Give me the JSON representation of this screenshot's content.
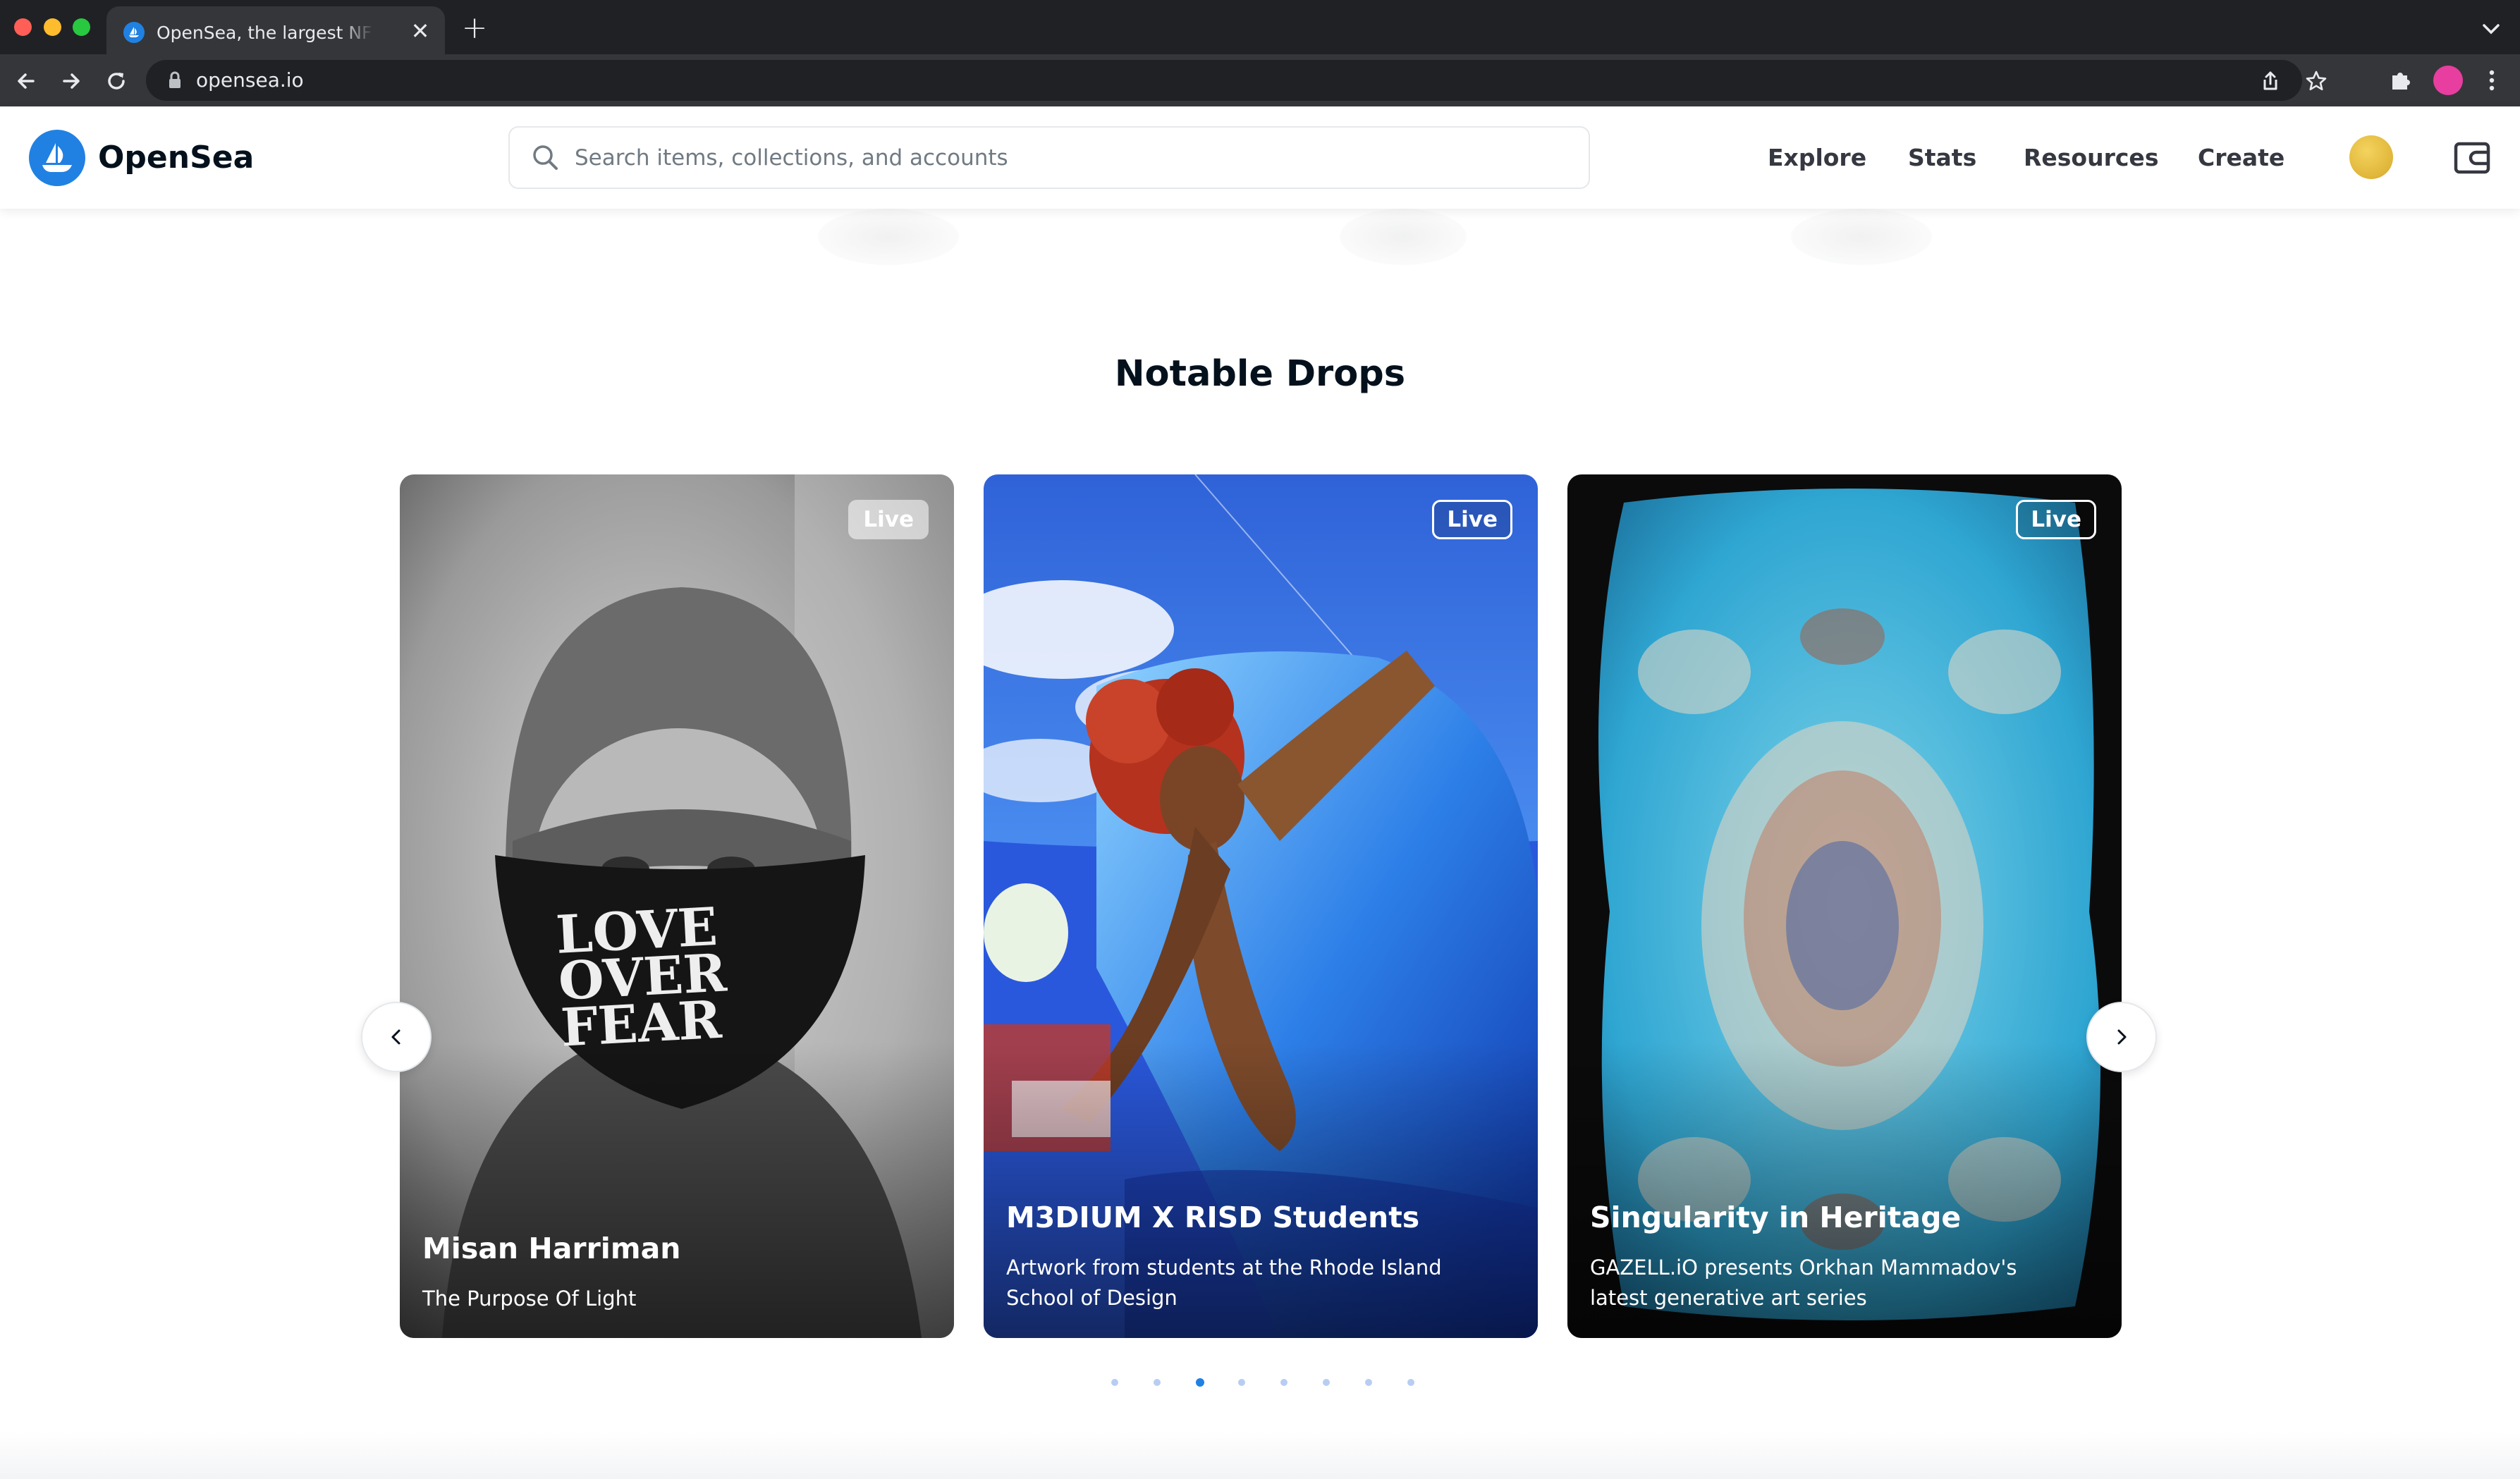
{
  "browser": {
    "tab_title": "OpenSea, the largest NFT marketplace",
    "close_glyph": "✕",
    "new_tab_glyph": "+",
    "url": "opensea.io"
  },
  "site": {
    "brand": "OpenSea",
    "search_placeholder": "Search items, collections, and accounts",
    "nav": [
      "Explore",
      "Stats",
      "Resources",
      "Create"
    ]
  },
  "section": {
    "title": "Notable Drops"
  },
  "cards": [
    {
      "badge": "Live",
      "title": "Misan Harriman",
      "subtitle": "The Purpose Of Light",
      "mask_text": [
        "LOVE",
        "OVER",
        "FEAR"
      ]
    },
    {
      "badge": "Live",
      "title": "M3DIUM X RISD Students",
      "subtitle": "Artwork from students at the Rhode Island School of Design"
    },
    {
      "badge": "Live",
      "title": "Singularity in Heritage",
      "subtitle": "GAZELL.iO presents Orkhan Mammadov's latest generative art series"
    }
  ],
  "carousel": {
    "page_count": 8,
    "active_index": 2
  },
  "colors": {
    "brand_blue": "#2081e2",
    "text_dark": "#04111d",
    "chrome_dark": "#202124",
    "chrome_mid": "#35363a"
  }
}
